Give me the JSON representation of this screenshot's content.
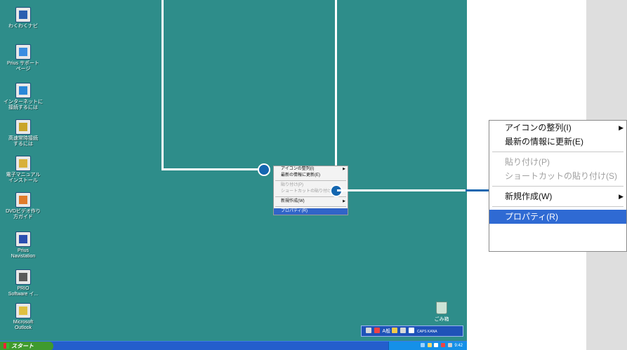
{
  "desktop_icons": [
    {
      "label": "わくわくナビ",
      "icon": "wakuwaku-navi-icon",
      "color": "#2a5fb0"
    },
    {
      "label": "Prius サポート\nページ",
      "icon": "support-page-icon",
      "color": "#3b8de0"
    },
    {
      "label": "インターネットに\n接続するには",
      "icon": "internet-connect-icon",
      "color": "#2a88d8"
    },
    {
      "label": "高速常時接続\nするには",
      "icon": "broadband-icon",
      "color": "#c9a52a"
    },
    {
      "label": "電子マニュアル\nインストール",
      "icon": "manual-install-icon",
      "color": "#d8b03a"
    },
    {
      "label": "DVDビデオ作り\n方ガイド",
      "icon": "dvd-guide-icon",
      "color": "#e07b2a"
    },
    {
      "label": "Prius\nNavistation",
      "icon": "navistation-icon",
      "color": "#2a4fb0"
    },
    {
      "label": "PRIO\nSoftware イ...",
      "icon": "prio-software-icon",
      "color": "#5a5a5a"
    },
    {
      "label": "Microsoft\nOutlook",
      "icon": "outlook-icon",
      "color": "#e0c040"
    }
  ],
  "context_menu_small": {
    "items": [
      {
        "label": "アイコンの整列(I)",
        "disabled": false,
        "submenu": true
      },
      {
        "label": "最新の情報に更新(E)",
        "disabled": false,
        "submenu": false
      },
      {
        "sep": true
      },
      {
        "label": "貼り付け(P)",
        "disabled": true,
        "submenu": false
      },
      {
        "label": "ショートカットの貼り付け(S)",
        "disabled": true,
        "submenu": false
      },
      {
        "sep": true
      },
      {
        "label": "新規作成(W)",
        "disabled": false,
        "submenu": true
      },
      {
        "sep": true
      },
      {
        "label": "プロパティ(R)",
        "disabled": false,
        "submenu": false,
        "selected": true
      }
    ]
  },
  "context_menu_large": {
    "items": [
      {
        "label": "アイコンの整列(I)",
        "disabled": false,
        "submenu": true
      },
      {
        "label": "最新の情報に更新(E)",
        "disabled": false,
        "submenu": false
      },
      {
        "sep": true
      },
      {
        "label": "貼り付け(P)",
        "disabled": true,
        "submenu": false
      },
      {
        "label": "ショートカットの貼り付け(S)",
        "disabled": true,
        "submenu": false
      },
      {
        "sep": true
      },
      {
        "label": "新規作成(W)",
        "disabled": false,
        "submenu": true
      },
      {
        "sep": true
      },
      {
        "label": "プロパティ(R)",
        "disabled": false,
        "submenu": false,
        "selected": true
      }
    ]
  },
  "trash": {
    "label": "ごみ箱"
  },
  "language_bar": {
    "text": "A般",
    "caps": "CAPS KANA"
  },
  "taskbar": {
    "start_label": "スタート",
    "clock": "9:42"
  },
  "colors": {
    "desktop": "#2e8d8a",
    "taskbar": "#245ecc",
    "start": "#3f9a2e",
    "selection": "#2f6ad3",
    "callout": "#1466b0"
  }
}
